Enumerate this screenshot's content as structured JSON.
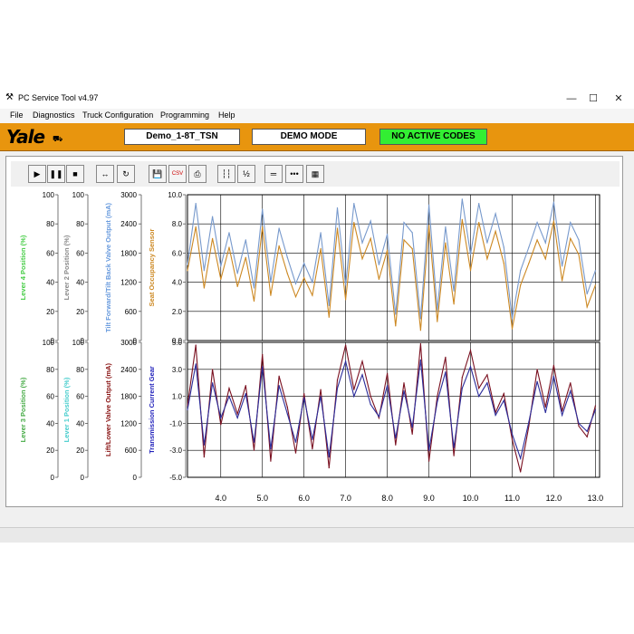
{
  "window": {
    "title": "PC Service Tool v4.97",
    "minimize": "—",
    "maximize": "☐",
    "close": "✕"
  },
  "menu": [
    "File",
    "Diagnostics",
    "Truck Configuration",
    "Programming",
    "Help"
  ],
  "header": {
    "logo": "Yale",
    "truck": "Demo_1-8T_TSN",
    "mode": "DEMO MODE",
    "codes": "NO ACTIVE CODES",
    "codes_color": "#33ee33",
    "brand_color": "#e8950e"
  },
  "toolbar": {
    "buttons": [
      {
        "name": "play",
        "glyph": "▶"
      },
      {
        "name": "pause",
        "glyph": "❚❚"
      },
      {
        "name": "stop",
        "glyph": "■"
      },
      {
        "name": "fit",
        "glyph": "↔"
      },
      {
        "name": "refresh",
        "glyph": "↻"
      },
      {
        "name": "save",
        "glyph": "💾"
      },
      {
        "name": "csv",
        "glyph": "CSV"
      },
      {
        "name": "print",
        "glyph": "⎙"
      },
      {
        "name": "cursor",
        "glyph": "┆┆"
      },
      {
        "name": "half",
        "glyph": "½"
      },
      {
        "name": "line",
        "glyph": "═"
      },
      {
        "name": "points",
        "glyph": "•••"
      },
      {
        "name": "grid",
        "glyph": "▦"
      }
    ]
  },
  "chart_data": [
    {
      "type": "line",
      "title": "",
      "x": [
        3.2,
        3.4,
        3.6,
        3.8,
        4.0,
        4.2,
        4.4,
        4.6,
        4.8,
        5.0,
        5.2,
        5.4,
        5.6,
        5.8,
        6.0,
        6.2,
        6.4,
        6.6,
        6.8,
        7.0,
        7.2,
        7.4,
        7.6,
        7.8,
        8.0,
        8.2,
        8.4,
        8.6,
        8.8,
        9.0,
        9.2,
        9.4,
        9.6,
        9.8,
        10.0,
        10.2,
        10.4,
        10.6,
        10.8,
        11.0,
        11.2,
        11.4,
        11.6,
        11.8,
        12.0,
        12.2,
        12.4,
        12.6,
        12.8,
        13.0
      ],
      "xlim": [
        3.2,
        13.1
      ],
      "xticks": [
        "4.0",
        "5.0",
        "6.0",
        "7.0",
        "8.0",
        "9.0",
        "10.0",
        "11.0",
        "12.0",
        "13.0"
      ],
      "axes": [
        {
          "label": "Lever 4 Position (%)",
          "ticks": [
            "100",
            "80",
            "60",
            "40",
            "20",
            "0"
          ],
          "color": "#44cc44"
        },
        {
          "label": "Lever 2 Position (%)",
          "ticks": [
            "100",
            "80",
            "60",
            "40",
            "20",
            "0"
          ],
          "color": "#888888"
        },
        {
          "label": "Tilt Forward/Tilt Back Valve Output (mA)",
          "ticks": [
            "3000",
            "2400",
            "1800",
            "1200",
            "600",
            "0"
          ],
          "color": "#6699dd"
        },
        {
          "label": "Seat Occupancy Sensor",
          "ticks": [],
          "color": "#cc8822"
        },
        {
          "label": "",
          "ticks": [
            "10.0",
            "8.0",
            "6.0",
            "4.0",
            "2.0",
            "0.0"
          ],
          "color": "#000000"
        }
      ],
      "ylim": [
        0,
        10
      ],
      "series": [
        {
          "color": "#7799cc",
          "values": [
            5.2,
            9.4,
            4.8,
            8.5,
            5.1,
            7.4,
            4.6,
            6.9,
            3.6,
            9.0,
            4.0,
            7.7,
            5.7,
            3.9,
            5.3,
            4.0,
            7.4,
            2.4,
            9.1,
            3.8,
            9.4,
            6.7,
            8.2,
            5.2,
            7.3,
            1.8,
            8.1,
            7.4,
            1.5,
            9.3,
            2.1,
            7.8,
            3.4,
            9.7,
            5.9,
            9.4,
            6.7,
            8.7,
            6.4,
            1.5,
            4.8,
            6.4,
            8.1,
            6.7,
            9.5,
            5.1,
            8.1,
            6.9,
            3.2,
            4.8
          ]
        },
        {
          "color": "#cc8822",
          "values": [
            4.8,
            7.8,
            3.6,
            7.0,
            4.2,
            6.4,
            3.7,
            5.7,
            2.7,
            7.8,
            3.1,
            6.5,
            4.6,
            3.0,
            4.3,
            3.1,
            6.3,
            1.6,
            7.7,
            2.8,
            8.1,
            5.6,
            7.0,
            4.2,
            6.2,
            1.0,
            6.9,
            6.3,
            0.7,
            7.9,
            1.3,
            6.7,
            2.5,
            8.3,
            4.8,
            8.1,
            5.6,
            7.5,
            5.3,
            0.8,
            3.8,
            5.3,
            6.9,
            5.6,
            8.2,
            4.1,
            7.0,
            5.9,
            2.3,
            3.8
          ]
        }
      ]
    },
    {
      "type": "line",
      "title": "",
      "x": [
        3.2,
        3.4,
        3.6,
        3.8,
        4.0,
        4.2,
        4.4,
        4.6,
        4.8,
        5.0,
        5.2,
        5.4,
        5.6,
        5.8,
        6.0,
        6.2,
        6.4,
        6.6,
        6.8,
        7.0,
        7.2,
        7.4,
        7.6,
        7.8,
        8.0,
        8.2,
        8.4,
        8.6,
        8.8,
        9.0,
        9.2,
        9.4,
        9.6,
        9.8,
        10.0,
        10.2,
        10.4,
        10.6,
        10.8,
        11.0,
        11.2,
        11.4,
        11.6,
        11.8,
        12.0,
        12.2,
        12.4,
        12.6,
        12.8,
        13.0
      ],
      "xlim": [
        3.2,
        13.1
      ],
      "xticks": [
        "4.0",
        "5.0",
        "6.0",
        "7.0",
        "8.0",
        "9.0",
        "10.0",
        "11.0",
        "12.0",
        "13.0"
      ],
      "axes": [
        {
          "label": "Lever 3 Position (%)",
          "ticks": [
            "100",
            "80",
            "60",
            "40",
            "20",
            "0"
          ],
          "color": "#44aa44"
        },
        {
          "label": "Lever 1 Position (%)",
          "ticks": [
            "100",
            "80",
            "60",
            "40",
            "20",
            "0"
          ],
          "color": "#44cccc"
        },
        {
          "label": "Lift/Lower Valve Output (mA)",
          "ticks": [
            "3000",
            "2400",
            "1800",
            "1200",
            "600",
            "0"
          ],
          "color": "#881111"
        },
        {
          "label": "Transmission Current Gear",
          "ticks": [],
          "color": "#2222bb"
        },
        {
          "label": "",
          "ticks": [
            "5.0",
            "3.0",
            "1.0",
            "-1.0",
            "-3.0",
            "-5.0"
          ],
          "color": "#000000"
        }
      ],
      "ylim": [
        -5,
        5
      ],
      "series": [
        {
          "color": "#7a1020",
          "values": [
            0.3,
            4.8,
            -3.5,
            3.0,
            -1.1,
            1.6,
            -0.3,
            1.8,
            -3.0,
            4.1,
            -3.8,
            2.5,
            0.2,
            -3.2,
            1.2,
            -2.9,
            1.5,
            -4.3,
            2.2,
            4.8,
            1.5,
            3.6,
            1.0,
            -0.6,
            2.7,
            -2.6,
            2.0,
            -1.8,
            4.9,
            -3.8,
            1.0,
            3.9,
            -3.4,
            2.4,
            4.4,
            1.6,
            2.6,
            -0.2,
            1.2,
            -2.2,
            -4.6,
            -1.2,
            3.0,
            0.2,
            3.3,
            -0.1,
            2.0,
            -1.2,
            -2.0,
            0.3
          ]
        },
        {
          "color": "#2b2c9a",
          "values": [
            0.0,
            3.4,
            -2.6,
            2.0,
            -0.6,
            1.0,
            -0.6,
            1.2,
            -2.4,
            3.2,
            -2.9,
            1.8,
            -0.3,
            -2.4,
            0.9,
            -2.2,
            1.0,
            -3.5,
            1.6,
            3.6,
            1.0,
            2.6,
            0.4,
            -0.5,
            1.8,
            -2.1,
            1.4,
            -1.3,
            3.7,
            -3.0,
            0.6,
            2.8,
            -2.8,
            1.6,
            3.2,
            1.0,
            2.0,
            -0.4,
            0.7,
            -1.8,
            -3.6,
            -0.9,
            2.1,
            -0.2,
            2.5,
            -0.4,
            1.4,
            -1.0,
            -1.6,
            0.0
          ]
        }
      ]
    }
  ]
}
